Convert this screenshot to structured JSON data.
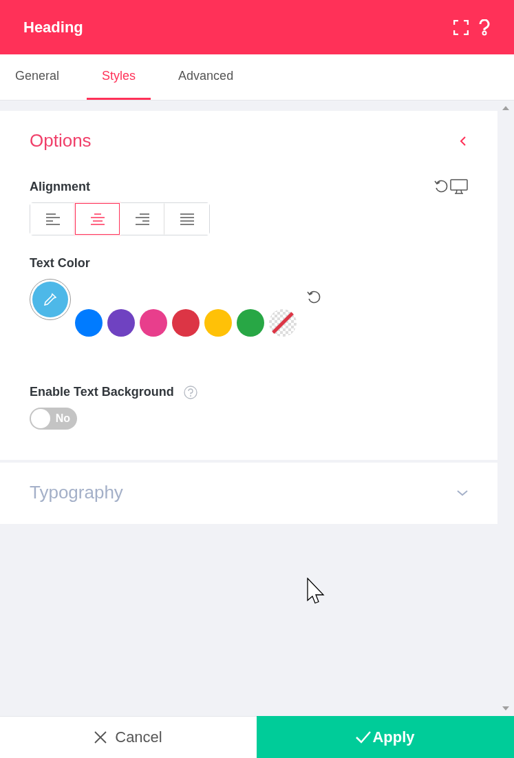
{
  "header": {
    "title": "Heading"
  },
  "tabs": [
    {
      "label": "General",
      "selected": false
    },
    {
      "label": "Styles",
      "selected": true
    },
    {
      "label": "Advanced",
      "selected": false
    }
  ],
  "options": {
    "title": "Options",
    "expanded": true,
    "alignment": {
      "label": "Alignment",
      "buttons": [
        {
          "kind": "left",
          "selected": false
        },
        {
          "kind": "center",
          "selected": true
        },
        {
          "kind": "right",
          "selected": false
        },
        {
          "kind": "justify",
          "selected": false
        }
      ]
    },
    "text_color": {
      "label": "Text Color",
      "swatches": [
        {
          "kind": "color",
          "color": "#007bff"
        },
        {
          "kind": "color",
          "color": "#6f42c1"
        },
        {
          "kind": "color",
          "color": "#e83e8c"
        },
        {
          "kind": "color",
          "color": "#dc3545"
        },
        {
          "kind": "color",
          "color": "#ffc107"
        },
        {
          "kind": "color",
          "color": "#28a745"
        },
        {
          "kind": "none"
        }
      ]
    },
    "text_background": {
      "label": "Enable Text Background",
      "on": false,
      "state_text": "No"
    }
  },
  "typography": {
    "title": "Typography",
    "expanded": false
  },
  "footer": {
    "cancel": "Cancel",
    "apply": "Apply"
  }
}
